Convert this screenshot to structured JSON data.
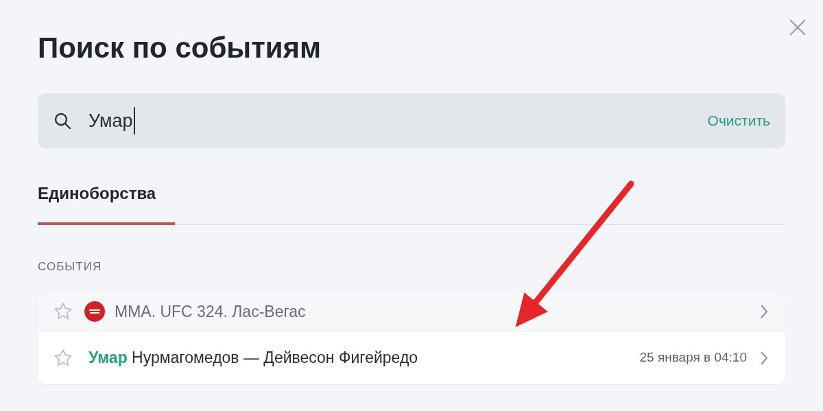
{
  "title": "Поиск по событиям",
  "search": {
    "value": "Умар",
    "clear_label": "Очистить"
  },
  "tabs": [
    {
      "label": "Единоборства",
      "selected": true
    }
  ],
  "section_label": "СОБЫТИЯ",
  "rows": [
    {
      "kind": "tournament",
      "text": "ММА. UFC 324. Лас-Вегас"
    },
    {
      "kind": "event",
      "match": "Умар",
      "text": "Нурмагомедов — Дейвесон Фигейредо",
      "time": "25 января в 04:10"
    }
  ]
}
